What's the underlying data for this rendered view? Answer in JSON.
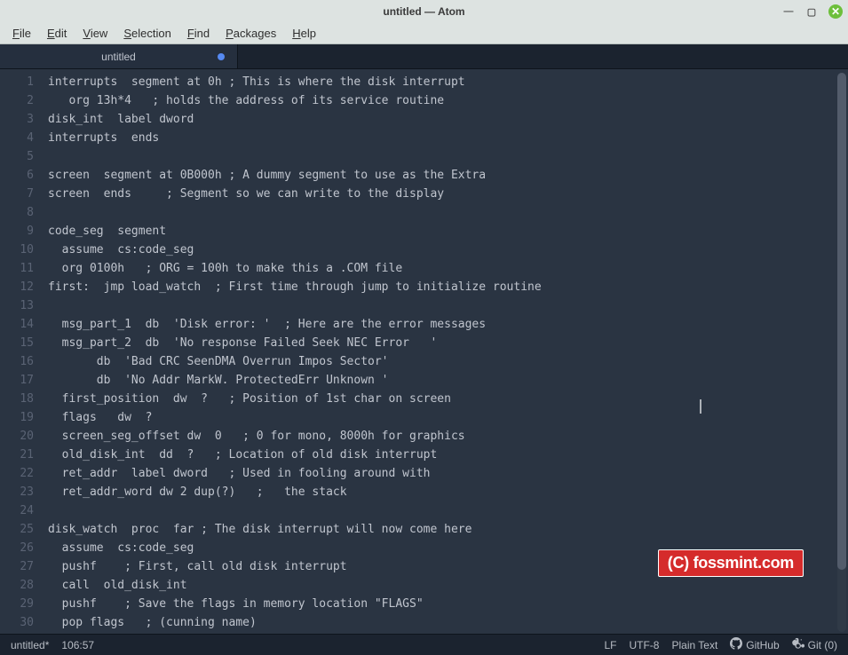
{
  "titlebar": {
    "title": "untitled — Atom"
  },
  "menubar": [
    {
      "label": "File",
      "m": "F"
    },
    {
      "label": "Edit",
      "m": "E"
    },
    {
      "label": "View",
      "m": "V"
    },
    {
      "label": "Selection",
      "m": "S"
    },
    {
      "label": "Find",
      "m": "F"
    },
    {
      "label": "Packages",
      "m": "P"
    },
    {
      "label": "Help",
      "m": "H"
    }
  ],
  "tab": {
    "title": "untitled",
    "modified": true
  },
  "code_lines": [
    "interrupts  segment at 0h ; This is where the disk interrupt",
    "   org 13h*4   ; holds the address of its service routine",
    "disk_int  label dword",
    "interrupts  ends",
    "",
    "screen  segment at 0B000h ; A dummy segment to use as the Extra",
    "screen  ends     ; Segment so we can write to the display",
    "",
    "code_seg  segment",
    "  assume  cs:code_seg",
    "  org 0100h   ; ORG = 100h to make this a .COM file",
    "first:  jmp load_watch  ; First time through jump to initialize routine",
    "",
    "  msg_part_1  db  'Disk error: '  ; Here are the error messages",
    "  msg_part_2  db  'No response Failed Seek NEC Error   '",
    "       db  'Bad CRC SeenDMA Overrun Impos Sector'",
    "       db  'No Addr MarkW. ProtectedErr Unknown '",
    "  first_position  dw  ?   ; Position of 1st char on screen",
    "  flags   dw  ?",
    "  screen_seg_offset dw  0   ; 0 for mono, 8000h for graphics",
    "  old_disk_int  dd  ?   ; Location of old disk interrupt",
    "  ret_addr  label dword   ; Used in fooling around with",
    "  ret_addr_word dw 2 dup(?)   ;   the stack",
    "",
    "disk_watch  proc  far ; The disk interrupt will now come here",
    "  assume  cs:code_seg",
    "  pushf    ; First, call old disk interrupt",
    "  call  old_disk_int",
    "  pushf    ; Save the flags in memory location \"FLAGS\"",
    "  pop flags   ; (cunning name)"
  ],
  "watermark": "(C) fossmint.com",
  "statusbar": {
    "filename": "untitled*",
    "cursor": "106:57",
    "eol": "LF",
    "encoding": "UTF-8",
    "grammar": "Plain Text",
    "github": "GitHub",
    "git": "Git (0)"
  }
}
